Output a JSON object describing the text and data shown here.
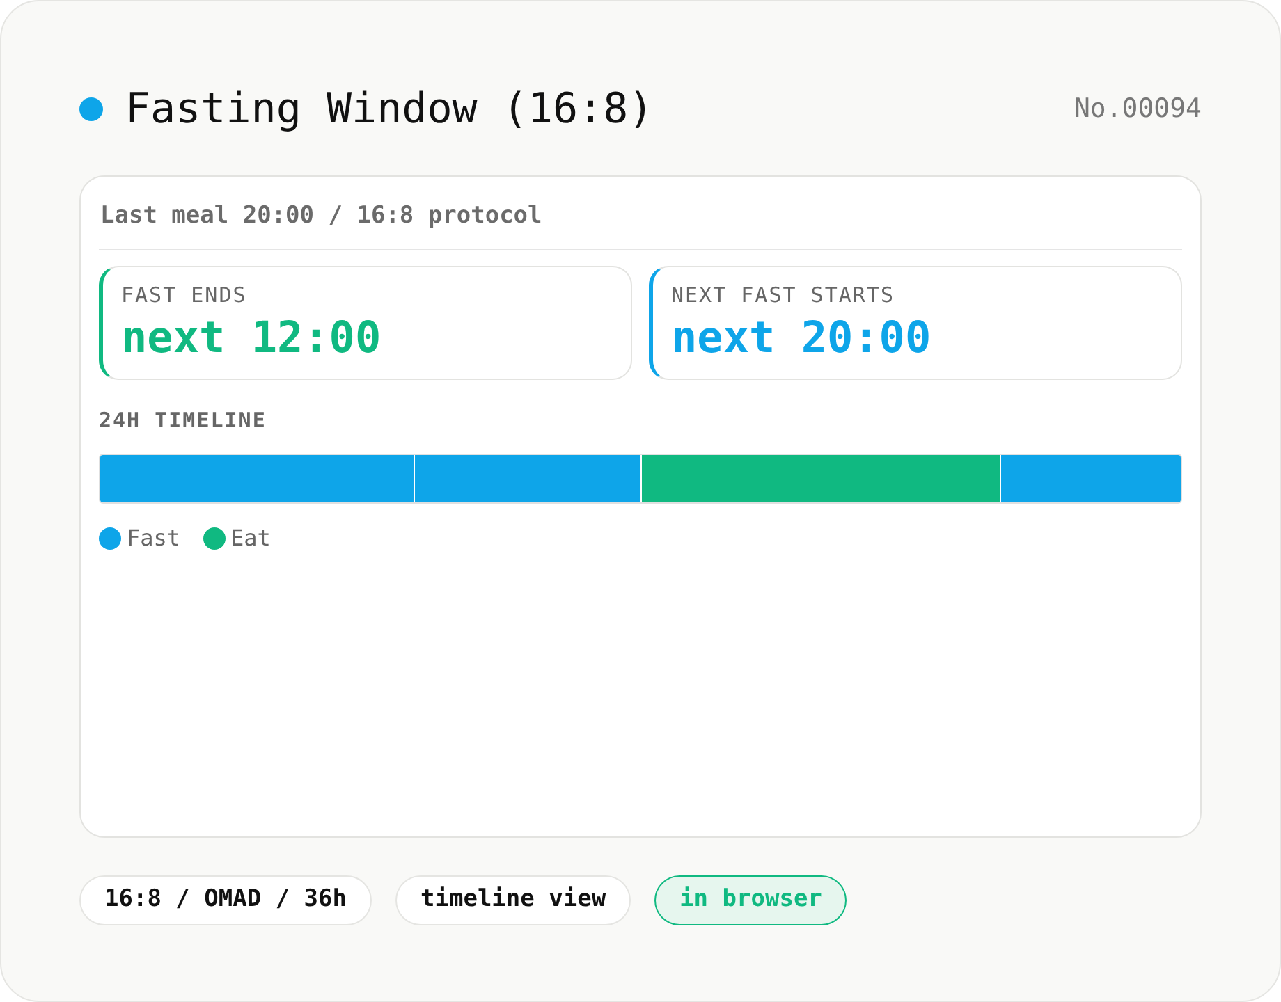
{
  "header": {
    "title": "Fasting Window (16:8)",
    "number": "No.00094"
  },
  "panel": {
    "subtitle": "Last meal 20:00 / 16:8 protocol",
    "stats": [
      {
        "label": "FAST ENDS",
        "value": "next 12:00",
        "color": "#10b981"
      },
      {
        "label": "NEXT FAST STARTS",
        "value": "next 20:00",
        "color": "#0ea5e9"
      }
    ],
    "timeline": {
      "title": "24H TIMELINE",
      "segments": [
        {
          "kind": "fast"
        },
        {
          "kind": "fast"
        },
        {
          "kind": "eat"
        },
        {
          "kind": "fast"
        }
      ],
      "legend": [
        {
          "label": "Fast",
          "color": "#0ea5e9"
        },
        {
          "label": "Eat",
          "color": "#10b981"
        }
      ]
    }
  },
  "chips": [
    {
      "label": "16:8 / OMAD / 36h",
      "selected": false
    },
    {
      "label": "timeline view",
      "selected": false
    },
    {
      "label": "in browser",
      "selected": true
    }
  ]
}
